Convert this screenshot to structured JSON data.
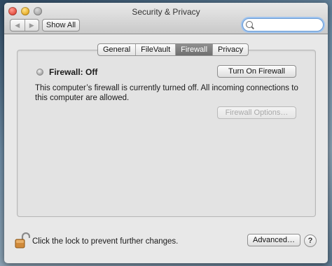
{
  "window": {
    "title": "Security & Privacy"
  },
  "toolbar": {
    "back_glyph": "◀",
    "forward_glyph": "▶",
    "show_all_label": "Show All",
    "search_placeholder": "",
    "search_value": ""
  },
  "tabs": [
    {
      "label": "General",
      "active": false
    },
    {
      "label": "FileVault",
      "active": false
    },
    {
      "label": "Firewall",
      "active": true
    },
    {
      "label": "Privacy",
      "active": false
    }
  ],
  "firewall": {
    "status_label": "Firewall: Off",
    "turn_on_label": "Turn On Firewall",
    "description": "This computer’s firewall is currently turned off. All incoming connections to this computer are allowed.",
    "options_label": "Firewall Options…"
  },
  "footer": {
    "lock_text": "Click the lock to prevent further changes.",
    "advanced_label": "Advanced…",
    "help_label": "?"
  },
  "colors": {
    "active_tab": "#7a7a7a",
    "close_button": "#e1473a",
    "minimize_button": "#e5a820",
    "lock_color": "#d08a3a"
  },
  "icons": {
    "close": "close-window-icon",
    "minimize": "minimize-window-icon",
    "zoom": "zoom-window-icon",
    "search": "search-icon",
    "lock": "unlocked-padlock-icon",
    "status": "status-dot-icon"
  }
}
